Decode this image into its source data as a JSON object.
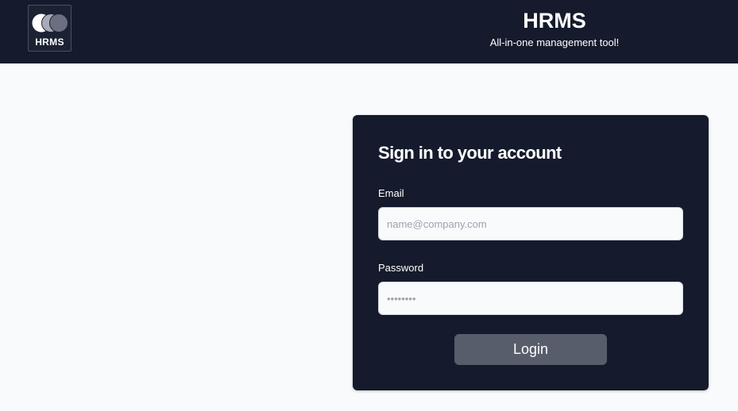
{
  "header": {
    "logo_text": "HRMS",
    "logo_icon": "overlapping-circles-icon",
    "title": "HRMS",
    "subtitle": "All-in-one management tool!"
  },
  "login": {
    "title": "Sign in to your account",
    "email_label": "Email",
    "email_placeholder": "name@company.com",
    "email_value": "",
    "password_label": "Password",
    "password_placeholder": "••••••••",
    "password_value": "",
    "login_label": "Login"
  },
  "colors": {
    "header_bg": "#151b2c",
    "card_bg": "#151b2c",
    "page_bg": "#f9fafb",
    "button_bg": "#575d6b",
    "input_bg": "#f9fafb"
  }
}
